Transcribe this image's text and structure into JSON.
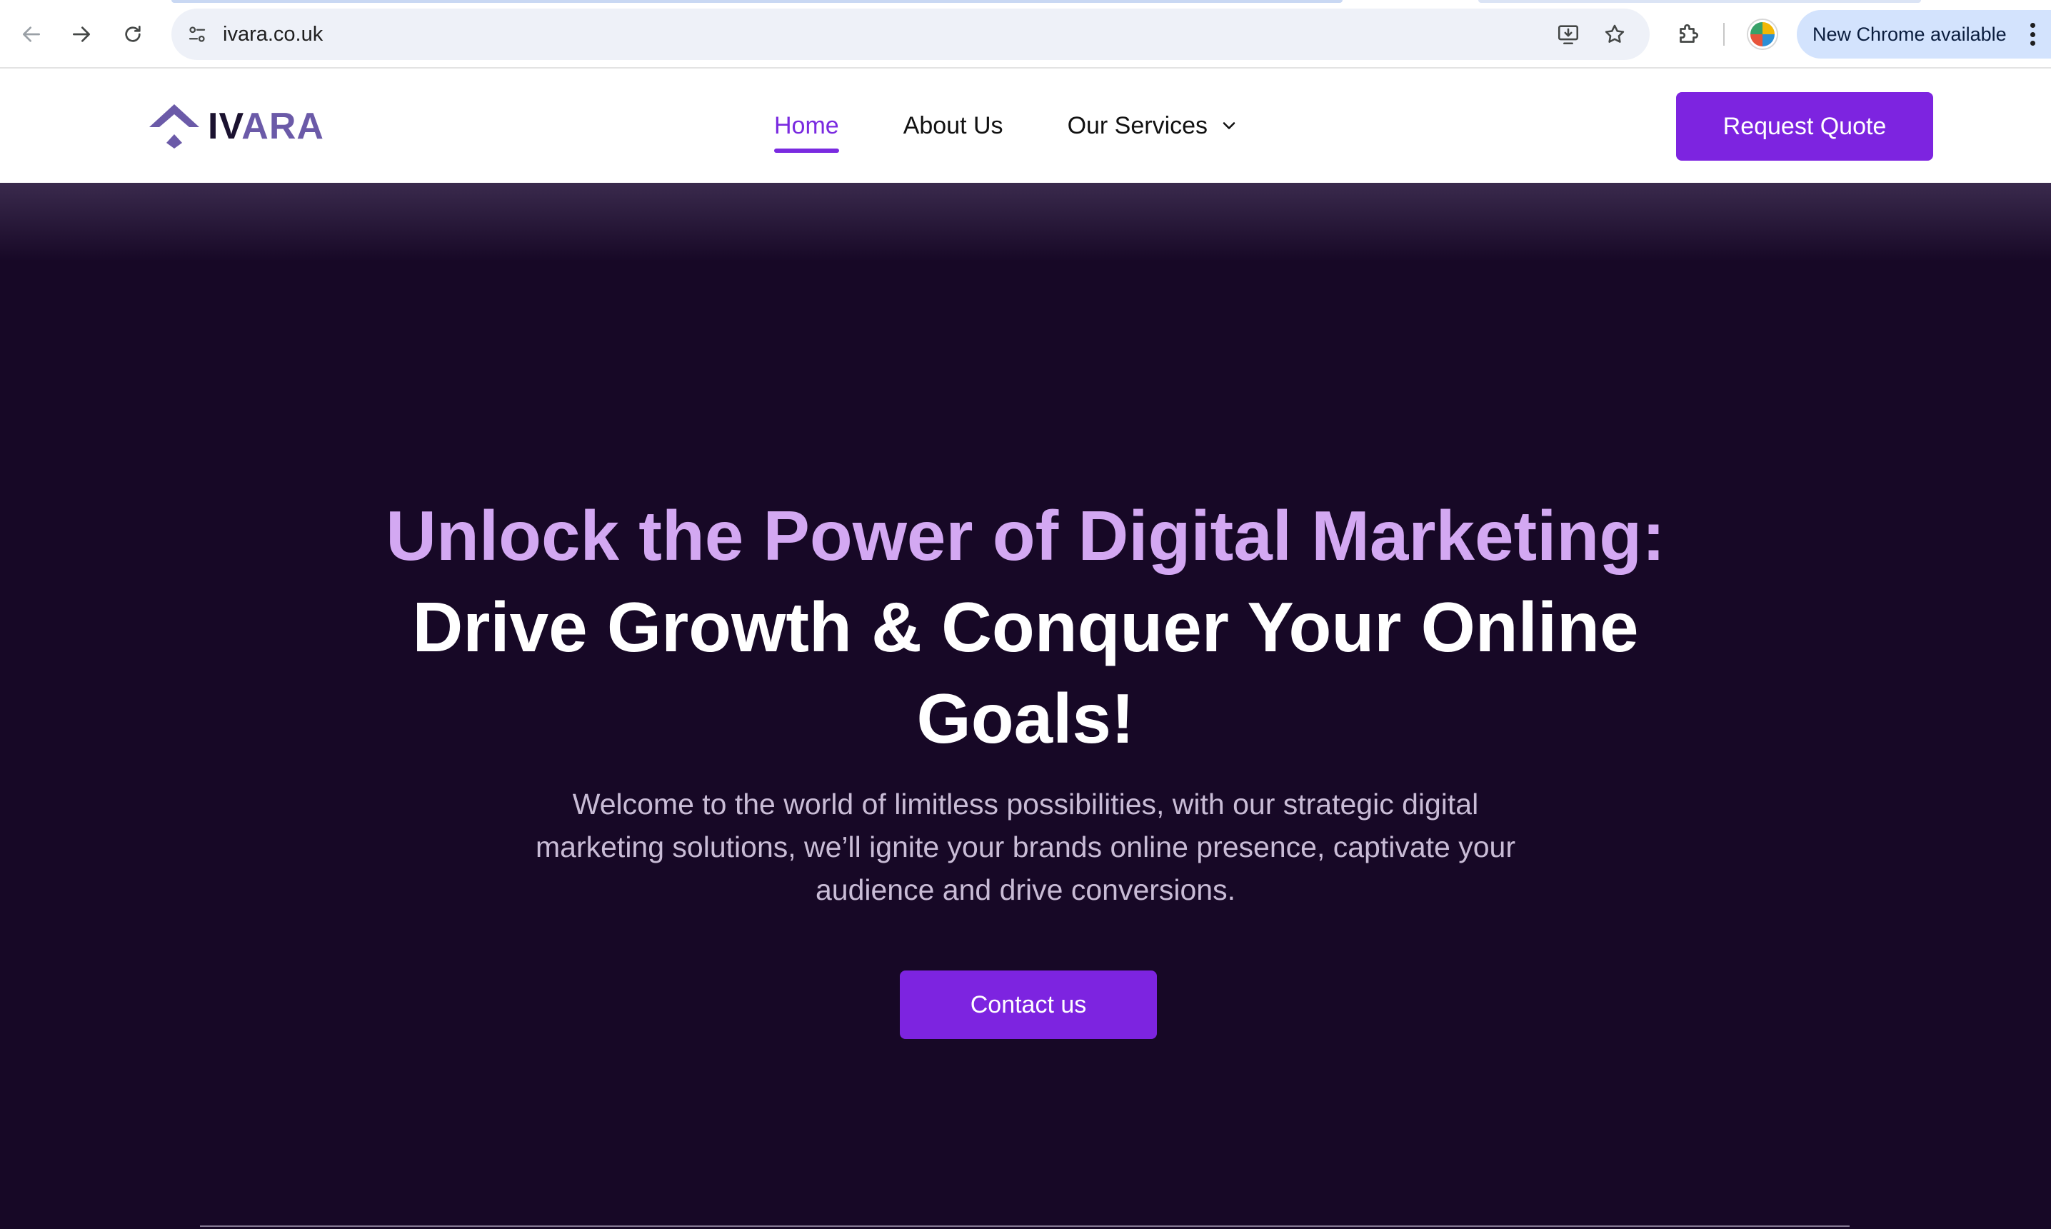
{
  "browser": {
    "url": "ivara.co.uk",
    "update_label": "New Chrome available",
    "icons": {
      "back": "back-arrow-icon",
      "forward": "forward-arrow-icon",
      "reload": "reload-icon",
      "site_info": "tune-icon",
      "install": "install-app-icon",
      "bookmark": "star-icon",
      "extensions": "puzzle-icon",
      "menu": "three-dots-icon"
    }
  },
  "site": {
    "logo": {
      "text_dark": "IV",
      "text_accent": "ARA"
    },
    "nav": {
      "home": "Home",
      "about": "About Us",
      "services": "Our Services"
    },
    "request_quote": "Request Quote"
  },
  "hero": {
    "headline_line1": "Unlock the Power of Digital Marketing:",
    "headline_line2": "Drive Growth & Conquer Your Online",
    "headline_line3": "Goals!",
    "intro": "Welcome to the world of limitless possibilities, with our strategic digital marketing solutions, we’ll ignite your brands online presence, captivate your audience and drive conversions.",
    "cta": "Contact us"
  },
  "colors": {
    "brand_purple": "#7d24e0",
    "hero_bg": "#170826",
    "headline_accent": "#d3a8f2",
    "logo_accent": "#6b5aa8"
  }
}
